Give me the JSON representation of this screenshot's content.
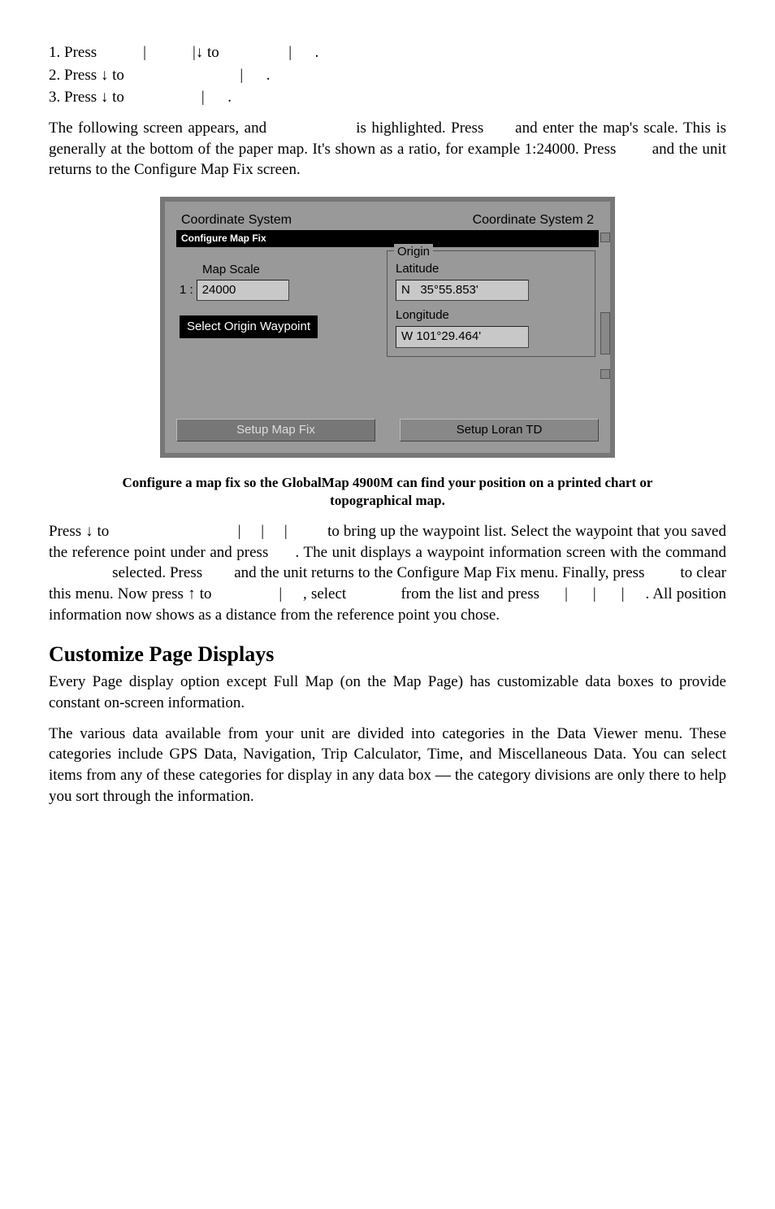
{
  "steps": {
    "s1a": "1. Press ",
    "s1b": "|",
    "s1c": "|↓ to ",
    "s1d": "|",
    "s1e": ".",
    "s2a": "2. Press ↓ to ",
    "s2b": "|",
    "s2c": ".",
    "s3a": "3. Press ↓ to ",
    "s3b": "|",
    "s3c": "."
  },
  "para1": "The following screen appears, and                 is highlighted. Press      and enter the map's scale. This is generally at the bottom of the paper map. It's shown as a ratio, for example 1:24000. Press        and the unit returns to the Configure Map Fix screen.",
  "ui": {
    "top_left": "Coordinate System",
    "top_right": "Coordinate System 2",
    "titlebar": "Configure Map Fix",
    "map_scale_label": "Map Scale",
    "map_scale_prefix": "1 :",
    "map_scale_value": "24000",
    "select_origin_btn": "Select Origin Waypoint",
    "origin_legend": "Origin",
    "lat_label": "Latitude",
    "lat_value": "N   35°55.853'",
    "lon_label": "Longitude",
    "lon_value": "W 101°29.464'",
    "setup_map_fix": "Setup Map Fix",
    "setup_loran": "Setup Loran TD"
  },
  "caption": "Configure a map fix so the GlobalMap 4900M can find your position on a printed chart or topographical map.",
  "para2": "Press ↓ to                                |     |     |          to bring up the waypoint list. Select the waypoint that you saved the reference point under and press      . The unit displays a waypoint information screen with the command                 selected. Press        and the unit returns to the Configure Map Fix menu. Finally, press         to clear this menu. Now press ↑ to                |     , select             from the list and press      |      |      |     . All position information now shows as a distance from the reference point you chose.",
  "section_heading": "Customize Page Displays",
  "para3": "Every Page display option except Full Map (on the Map Page) has customizable data boxes to provide constant on-screen information.",
  "para4": "The various data available from your unit are divided into categories in the Data Viewer menu. These categories include GPS Data, Navigation, Trip Calculator, Time, and Miscellaneous Data. You can select items from any of these categories for display in any data box — the category divisions are only there to help you sort through the information."
}
